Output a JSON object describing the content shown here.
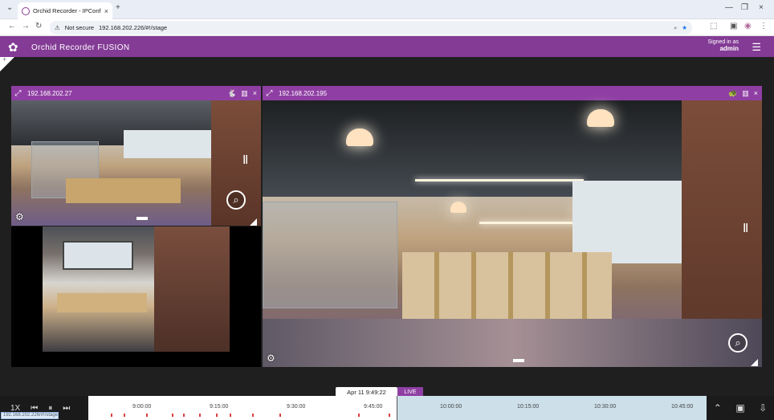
{
  "browser": {
    "tab_title": "Orchid Recorder - IPConfigure",
    "new_tab": "+",
    "tab_close": "×",
    "window_controls": [
      "—",
      "❐",
      "×"
    ],
    "back": "←",
    "forward": "→",
    "reload": "↻",
    "not_secure": "Not secure",
    "url": "192.168.202.226/#!/stage",
    "status_url": "192.168.202.226/#!/stage"
  },
  "app": {
    "brand": "Orchid Recorder",
    "suffix": "FUSION",
    "signed_in_as": "Signed in as",
    "user": "admin"
  },
  "panels": {
    "left_top": {
      "ip": "192.168.202.27",
      "tools": [
        "🐇",
        "▥",
        "×"
      ]
    },
    "right": {
      "ip": "192.168.202.195",
      "tools": [
        "🐢",
        "▥",
        "×"
      ]
    }
  },
  "player": {
    "speed": "1X",
    "date": "Apr 11 9:49:22",
    "live": "LIVE",
    "times": [
      "9:00:00",
      "9:15:00",
      "9:30:00",
      "9:45:00",
      "10:00:00",
      "10:15:00",
      "10:30:00",
      "10:45:00"
    ]
  },
  "colors": {
    "accent": "#8f3fa3",
    "app_bar": "#833b95",
    "live_zone": "#cde0ea"
  }
}
